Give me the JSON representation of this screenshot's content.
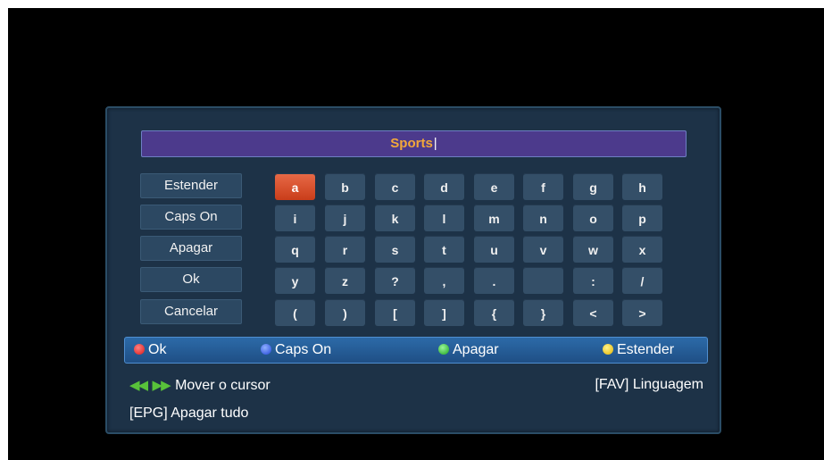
{
  "input": {
    "value": "Sports"
  },
  "side_buttons": [
    "Estender",
    "Caps On",
    "Apagar",
    "Ok",
    "Cancelar"
  ],
  "keyboard": {
    "selected": "a",
    "rows": [
      [
        "a",
        "b",
        "c",
        "d",
        "e",
        "f",
        "g",
        "h"
      ],
      [
        "i",
        "j",
        "k",
        "l",
        "m",
        "n",
        "o",
        "p"
      ],
      [
        "q",
        "r",
        "s",
        "t",
        "u",
        "v",
        "w",
        "x"
      ],
      [
        "y",
        "z",
        "?",
        ",",
        ".",
        "",
        ":",
        "/"
      ],
      [
        "(",
        ")",
        "[",
        "]",
        "{",
        "}",
        "<",
        ">"
      ]
    ]
  },
  "color_bar": {
    "red_label": "Ok",
    "blue_label": "Caps On",
    "green_label": "Apagar",
    "yellow_label": "Estender"
  },
  "help": {
    "cursor": "Mover o cursor",
    "fav": "[FAV] Linguagem",
    "epg": "[EPG] Apagar tudo"
  },
  "colors": {
    "accent_key": "#d9502a",
    "input_background": "#4c3a8c",
    "input_text": "#f2a83a",
    "dialog_background": "#1d3247"
  }
}
